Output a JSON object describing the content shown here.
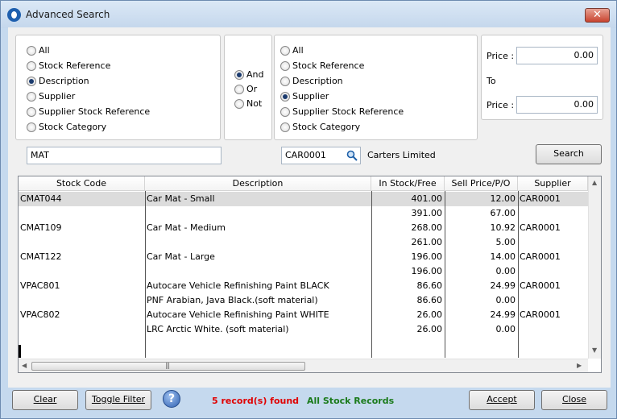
{
  "window": {
    "title": "Advanced Search",
    "close_glyph": "✕"
  },
  "left_group": {
    "options": [
      "All",
      "Stock Reference",
      "Description",
      "Supplier",
      "Supplier Stock Reference",
      "Stock Category"
    ],
    "selected": "Description"
  },
  "logic_group": {
    "options": [
      "And",
      "Or",
      "Not"
    ],
    "selected": "And"
  },
  "right_group": {
    "options": [
      "All",
      "Stock Reference",
      "Description",
      "Supplier",
      "Supplier Stock Reference",
      "Stock Category"
    ],
    "selected": "Supplier"
  },
  "price": {
    "from_label": "Price :",
    "from_value": "0.00",
    "to_label": "To",
    "to_field_label": "Price :",
    "to_value": "0.00"
  },
  "search": {
    "left_value": "MAT",
    "supplier_value": "CAR0001",
    "supplier_name": "Carters Limited",
    "button_label": "Search"
  },
  "grid": {
    "columns": [
      "Stock Code",
      "Description",
      "In Stock/Free",
      "Sell Price/P/O",
      "Supplier"
    ],
    "rows": [
      {
        "code": "CMAT044",
        "desc": "Car Mat - Small",
        "stock": "401.00",
        "price": "12.00",
        "supplier": "CAR0001"
      },
      {
        "code": "",
        "desc": "",
        "stock": "391.00",
        "price": "67.00",
        "supplier": ""
      },
      {
        "code": "CMAT109",
        "desc": "Car Mat - Medium",
        "stock": "268.00",
        "price": "10.92",
        "supplier": "CAR0001"
      },
      {
        "code": "",
        "desc": "",
        "stock": "261.00",
        "price": "5.00",
        "supplier": ""
      },
      {
        "code": "CMAT122",
        "desc": "Car Mat - Large",
        "stock": "196.00",
        "price": "14.00",
        "supplier": "CAR0001"
      },
      {
        "code": "",
        "desc": "",
        "stock": "196.00",
        "price": "0.00",
        "supplier": ""
      },
      {
        "code": "VPAC801",
        "desc": "Autocare Vehicle Refinishing Paint BLACK",
        "stock": "86.60",
        "price": "24.99",
        "supplier": "CAR0001"
      },
      {
        "code": "",
        "desc": "PNF Arabian, Java Black.(soft material)",
        "stock": "86.60",
        "price": "0.00",
        "supplier": ""
      },
      {
        "code": "VPAC802",
        "desc": "Autocare Vehicle Refinishing Paint WHITE",
        "stock": "26.00",
        "price": "24.99",
        "supplier": "CAR0001"
      },
      {
        "code": "",
        "desc": "LRC Arctic White. (soft material)",
        "stock": "26.00",
        "price": "0.00",
        "supplier": ""
      }
    ],
    "selected_row": 0
  },
  "footer": {
    "clear_label": "Clear",
    "toggle_filter_label": "Toggle Filter",
    "help_glyph": "?",
    "records_found": "5 record(s) found",
    "records_scope": "All Stock Records",
    "accept_label": "Accept",
    "close_label": "Close"
  },
  "colors": {
    "records_found": "#e00000",
    "records_scope": "#1a7a1a",
    "window_frame": "#c5d9ee"
  }
}
